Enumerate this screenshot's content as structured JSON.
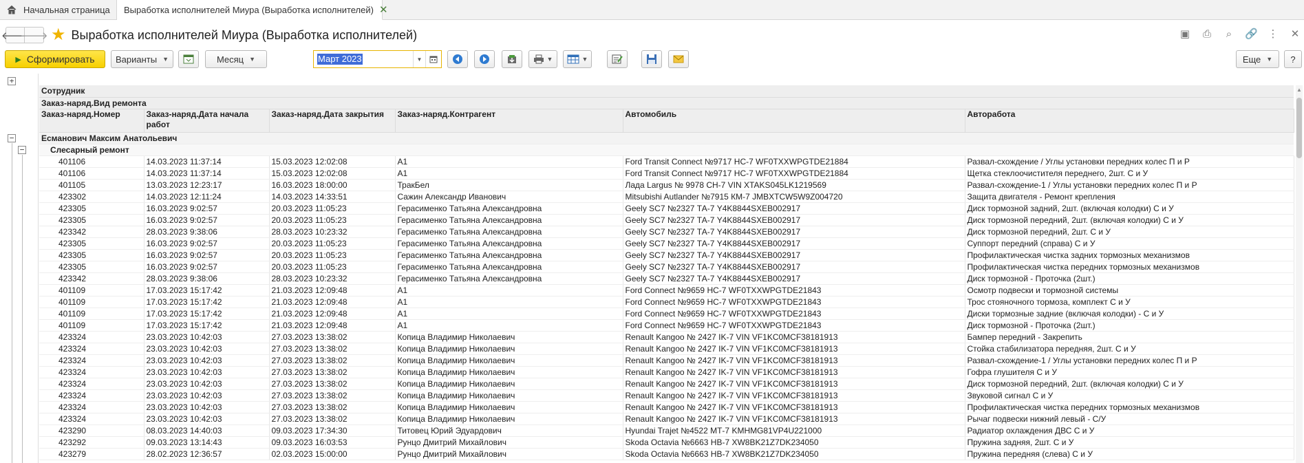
{
  "tabs": {
    "home_label": "Начальная страница",
    "active_label": "Выработка исполнителей Миура (Выработка исполнителей)"
  },
  "title": "Выработка исполнителей Миура (Выработка исполнителей)",
  "toolbar": {
    "generate_label": "Сформировать",
    "variants_label": "Варианты",
    "period_type_label": "Месяц",
    "period_value": "Март 2023",
    "more_label": "Еще",
    "help_label": "?"
  },
  "report": {
    "header_rows": {
      "employee": "Сотрудник",
      "repair_type": "Заказ-наряд.Вид ремонта"
    },
    "columns": [
      "Заказ-наряд.Номер",
      "Заказ-наряд.Дата начала работ",
      "Заказ-наряд.Дата закрытия",
      "Заказ-наряд.Контрагент",
      "Автомобиль",
      "Авторабота"
    ],
    "group_employee": "Есманович Максим Анатольевич",
    "group_repair": "Слесарный ремонт",
    "rows": [
      [
        "401106",
        "14.03.2023 11:37:14",
        "15.03.2023 12:02:08",
        "А1",
        "Ford Transit Connect №9717 НС-7 WF0TXXWPGTDE21884",
        "Развал-схождение / Углы установки передних колес П и Р"
      ],
      [
        "401106",
        "14.03.2023 11:37:14",
        "15.03.2023 12:02:08",
        "А1",
        "Ford Transit Connect №9717 НС-7 WF0TXXWPGTDE21884",
        "Щетка стеклоочистителя переднего, 2шт. С и У"
      ],
      [
        "401105",
        "13.03.2023 12:23:17",
        "16.03.2023 18:00:00",
        "ТракБел",
        "Лада Largus № 9978 СН-7 VIN XTAKS045LK1219569",
        "Развал-схождение-1 / Углы установки передних колес П и Р"
      ],
      [
        "423302",
        "14.03.2023 12:11:24",
        "14.03.2023 14:33:51",
        "Сажин Александр Иванович",
        "Mitsubishi Autlander №7915 КМ-7 JMBXTCW5W9Z004720",
        "Защита двигателя - Ремонт крепления"
      ],
      [
        "423305",
        "16.03.2023 9:02:57",
        "20.03.2023 11:05:23",
        "Герасименко Татьяна Александровна",
        "Geely SC7 №2327 ТА-7 Y4K8844SXEB002917",
        "Диск тормозной задний, 2шт. (включая колодки) С и У"
      ],
      [
        "423305",
        "16.03.2023 9:02:57",
        "20.03.2023 11:05:23",
        "Герасименко Татьяна Александровна",
        "Geely SC7 №2327 ТА-7 Y4K8844SXEB002917",
        "Диск тормозной передний, 2шт. (включая колодки) С и У"
      ],
      [
        "423342",
        "28.03.2023 9:38:06",
        "28.03.2023 10:23:32",
        "Герасименко Татьяна Александровна",
        "Geely SC7 №2327 ТА-7 Y4K8844SXEB002917",
        "Диск тормозной передний, 2шт. С и У"
      ],
      [
        "423305",
        "16.03.2023 9:02:57",
        "20.03.2023 11:05:23",
        "Герасименко Татьяна Александровна",
        "Geely SC7 №2327 ТА-7 Y4K8844SXEB002917",
        "Суппорт передний (справа) С и У"
      ],
      [
        "423305",
        "16.03.2023 9:02:57",
        "20.03.2023 11:05:23",
        "Герасименко Татьяна Александровна",
        "Geely SC7 №2327 ТА-7 Y4K8844SXEB002917",
        "Профилактическая чистка задних тормозных механизмов"
      ],
      [
        "423305",
        "16.03.2023 9:02:57",
        "20.03.2023 11:05:23",
        "Герасименко Татьяна Александровна",
        "Geely SC7 №2327 ТА-7 Y4K8844SXEB002917",
        "Профилактическая чистка передних тормозных механизмов"
      ],
      [
        "423342",
        "28.03.2023 9:38:06",
        "28.03.2023 10:23:32",
        "Герасименко Татьяна Александровна",
        "Geely SC7 №2327 ТА-7 Y4K8844SXEB002917",
        "Диск тормозной - Проточка (2шт.)"
      ],
      [
        "401109",
        "17.03.2023 15:17:42",
        "21.03.2023 12:09:48",
        "А1",
        "Ford Connect №9659 НС-7 WF0TXXWPGTDE21843",
        "Осмотр подвески и тормозной системы"
      ],
      [
        "401109",
        "17.03.2023 15:17:42",
        "21.03.2023 12:09:48",
        "А1",
        "Ford Connect №9659 НС-7 WF0TXXWPGTDE21843",
        "Трос стояночного тормоза, комплект С и У"
      ],
      [
        "401109",
        "17.03.2023 15:17:42",
        "21.03.2023 12:09:48",
        "А1",
        "Ford Connect №9659 НС-7 WF0TXXWPGTDE21843",
        "Диски тормозные задние (включая колодки) - С и У"
      ],
      [
        "401109",
        "17.03.2023 15:17:42",
        "21.03.2023 12:09:48",
        "А1",
        "Ford Connect №9659 НС-7 WF0TXXWPGTDE21843",
        "Диск тормозной - Проточка (2шт.)"
      ],
      [
        "423324",
        "23.03.2023 10:42:03",
        "27.03.2023 13:38:02",
        "Копица Владимир Николаевич",
        "Renault Kangoo № 2427 IK-7 VIN VF1KC0MCF38181913",
        "Бампер передний - Закрепить"
      ],
      [
        "423324",
        "23.03.2023 10:42:03",
        "27.03.2023 13:38:02",
        "Копица Владимир Николаевич",
        "Renault Kangoo № 2427 IK-7 VIN VF1KC0MCF38181913",
        "Стойка стабилизатора передняя, 2шт. С и У"
      ],
      [
        "423324",
        "23.03.2023 10:42:03",
        "27.03.2023 13:38:02",
        "Копица Владимир Николаевич",
        "Renault Kangoo № 2427 IK-7 VIN VF1KC0MCF38181913",
        "Развал-схождение-1 / Углы установки передних колес П и Р"
      ],
      [
        "423324",
        "23.03.2023 10:42:03",
        "27.03.2023 13:38:02",
        "Копица Владимир Николаевич",
        "Renault Kangoo № 2427 IK-7 VIN VF1KC0MCF38181913",
        "Гофра глушителя С и У"
      ],
      [
        "423324",
        "23.03.2023 10:42:03",
        "27.03.2023 13:38:02",
        "Копица Владимир Николаевич",
        "Renault Kangoo № 2427 IK-7 VIN VF1KC0MCF38181913",
        "Диск тормозной передний, 2шт. (включая колодки) С и У"
      ],
      [
        "423324",
        "23.03.2023 10:42:03",
        "27.03.2023 13:38:02",
        "Копица Владимир Николаевич",
        "Renault Kangoo № 2427 IK-7 VIN VF1KC0MCF38181913",
        "Звуковой сигнал С и У"
      ],
      [
        "423324",
        "23.03.2023 10:42:03",
        "27.03.2023 13:38:02",
        "Копица Владимир Николаевич",
        "Renault Kangoo № 2427 IK-7 VIN VF1KC0MCF38181913",
        "Профилактическая чистка передних тормозных механизмов"
      ],
      [
        "423324",
        "23.03.2023 10:42:03",
        "27.03.2023 13:38:02",
        "Копица Владимир Николаевич",
        "Renault Kangoo № 2427 IK-7 VIN VF1KC0MCF38181913",
        "Рычаг подвески нижний левый - С/У"
      ],
      [
        "423290",
        "08.03.2023 14:40:03",
        "09.03.2023 17:34:30",
        "Титовец Юрий Эдуардович",
        "Hyundai Trajet №4522 МТ-7 KMHMG81VP4U221000",
        "Радиатор охлаждения ДВС С и У"
      ],
      [
        "423292",
        "09.03.2023 13:14:43",
        "09.03.2023 16:03:53",
        "Рунцо Дмитрий Михайлович",
        "Skoda Octavia №6663 НВ-7 XW8BK21Z7DK234050",
        "Пружина задняя, 2шт. С и У"
      ],
      [
        "423279",
        "28.02.2023 12:36:57",
        "02.03.2023 15:00:00",
        "Рунцо Дмитрий Михайлович",
        "Skoda Octavia №6663 НВ-7 XW8BK21Z7DK234050",
        "Пружина передняя (слева) С и У"
      ]
    ]
  }
}
